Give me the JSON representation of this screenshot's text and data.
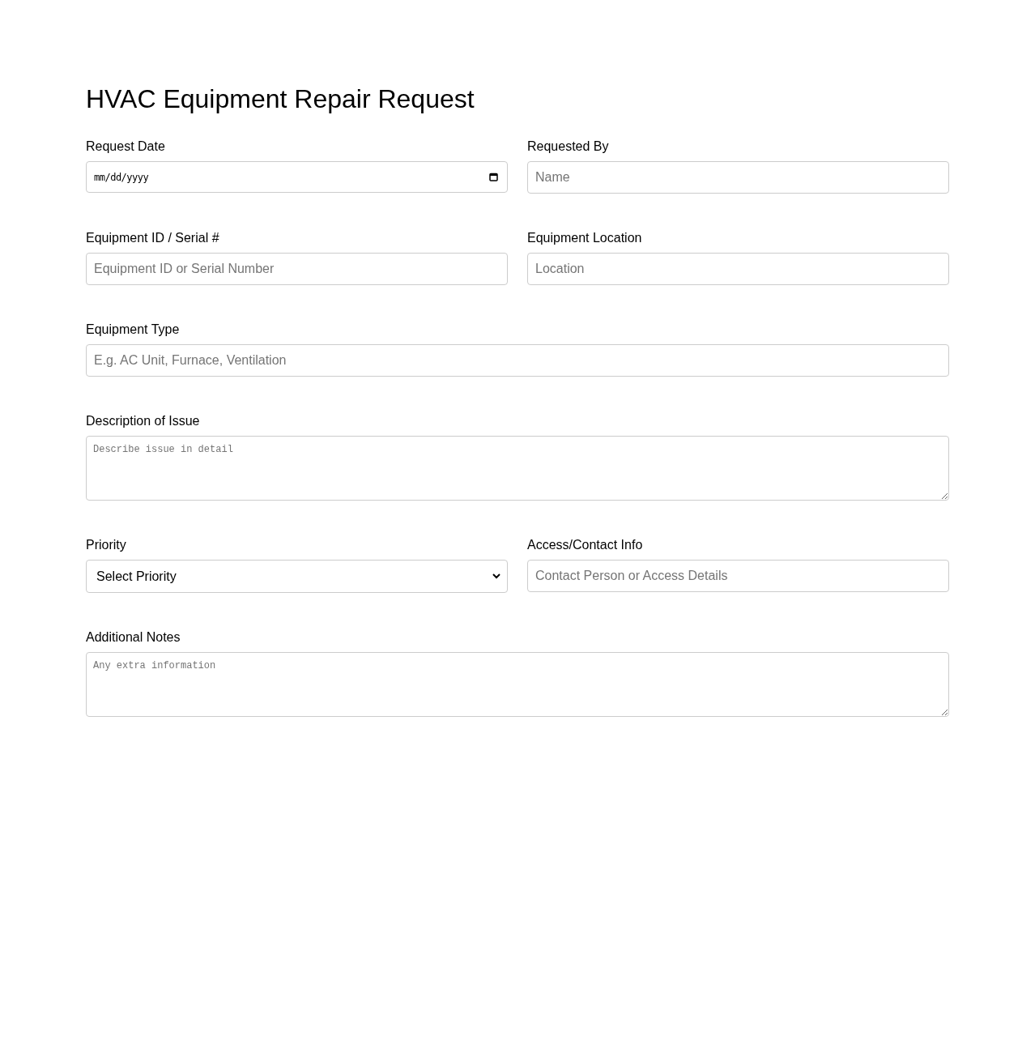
{
  "title": "HVAC Equipment Repair Request",
  "rows": [
    {
      "fields": [
        {
          "kind": "date",
          "label": "Request Date",
          "placeholder": "mm/dd/yyyy"
        },
        {
          "kind": "text",
          "label": "Requested By",
          "placeholder": "Name"
        }
      ]
    },
    {
      "fields": [
        {
          "kind": "text",
          "label": "Equipment ID / Serial #",
          "placeholder": "Equipment ID or Serial Number"
        },
        {
          "kind": "text",
          "label": "Equipment Location",
          "placeholder": "Location"
        }
      ]
    },
    {
      "fields": [
        {
          "kind": "text",
          "label": "Equipment Type",
          "placeholder": "E.g. AC Unit, Furnace, Ventilation"
        }
      ]
    },
    {
      "fields": [
        {
          "kind": "textarea",
          "label": "Description of Issue",
          "placeholder": "Describe issue in detail"
        }
      ]
    },
    {
      "fields": [
        {
          "kind": "select",
          "label": "Priority",
          "value": "Select Priority"
        },
        {
          "kind": "text",
          "label": "Access/Contact Info",
          "placeholder": "Contact Person or Access Details"
        }
      ]
    },
    {
      "fields": [
        {
          "kind": "textarea",
          "label": "Additional Notes",
          "placeholder": "Any extra information"
        }
      ]
    }
  ]
}
